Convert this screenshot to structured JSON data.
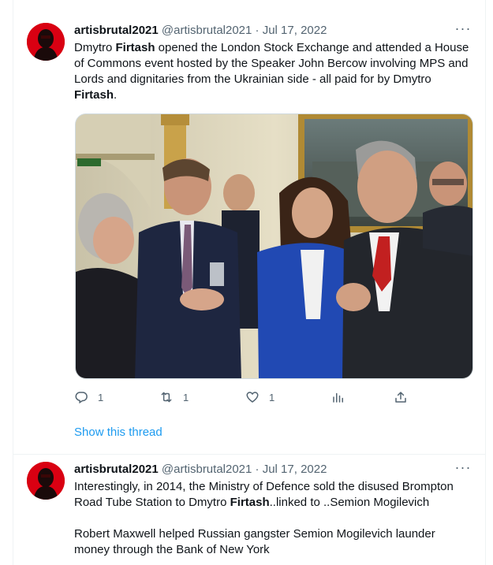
{
  "tweets": [
    {
      "display_name": "artisbrutal2021",
      "handle": "@artisbrutal2021",
      "separator": "·",
      "date": "Jul 17, 2022",
      "more": "···",
      "text_parts": [
        {
          "text": "Dmytro ",
          "bold": false
        },
        {
          "text": "Firtash",
          "bold": true
        },
        {
          "text": " opened the London Stock Exchange and attended  a House of Commons event hosted by the Speaker John Bercow  involving MPS and Lords and dignitaries from the Ukrainian side - all paid for by Dmytro ",
          "bold": false
        },
        {
          "text": "Firtash",
          "bold": true
        },
        {
          "text": ".",
          "bold": false
        }
      ],
      "has_media": true,
      "actions": {
        "reply": {
          "icon": "reply-icon",
          "count": "1"
        },
        "retweet": {
          "icon": "retweet-icon",
          "count": "1"
        },
        "like": {
          "icon": "heart-icon",
          "count": "1"
        },
        "views": {
          "icon": "analytics-icon"
        },
        "share": {
          "icon": "share-icon"
        }
      },
      "show_thread": "Show this thread"
    },
    {
      "display_name": "artisbrutal2021",
      "handle": "@artisbrutal2021",
      "separator": "·",
      "date": "Jul 17, 2022",
      "more": "···",
      "para1_parts": [
        {
          "text": "Interestingly, in 2014, the Ministry of Defence sold the disused Brompton Road Tube Station to  Dmytro ",
          "bold": false
        },
        {
          "text": "Firtash",
          "bold": true
        },
        {
          "text": "..linked to ..Semion Mogilevich",
          "bold": false
        }
      ],
      "para2": "Robert Maxwell helped Russian gangster Semion Mogilevich launder money through the Bank of New York"
    }
  ],
  "colors": {
    "accent": "#1d9bf0",
    "secondary_text": "#536471",
    "avatar_bg": "#d90012"
  }
}
